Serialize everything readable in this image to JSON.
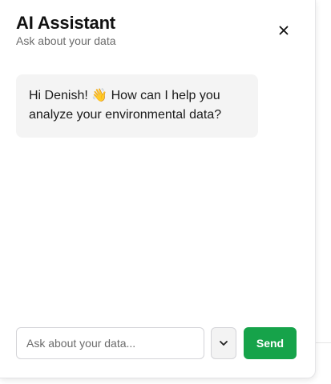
{
  "header": {
    "title": "AI Assistant",
    "subtitle": "Ask about your data",
    "close_icon": "close-icon"
  },
  "messages": [
    {
      "role": "assistant",
      "text": "Hi Denish! 👋 How can I help you analyze your environmental data?"
    }
  ],
  "composer": {
    "placeholder": "Ask about your data...",
    "value": "",
    "dropdown_icon": "chevron-down-icon",
    "send_label": "Send"
  },
  "colors": {
    "accent": "#16a34a",
    "bubble_bg": "#f4f4f4",
    "title_text": "#111111",
    "subtitle_text": "#6b6b6b"
  }
}
